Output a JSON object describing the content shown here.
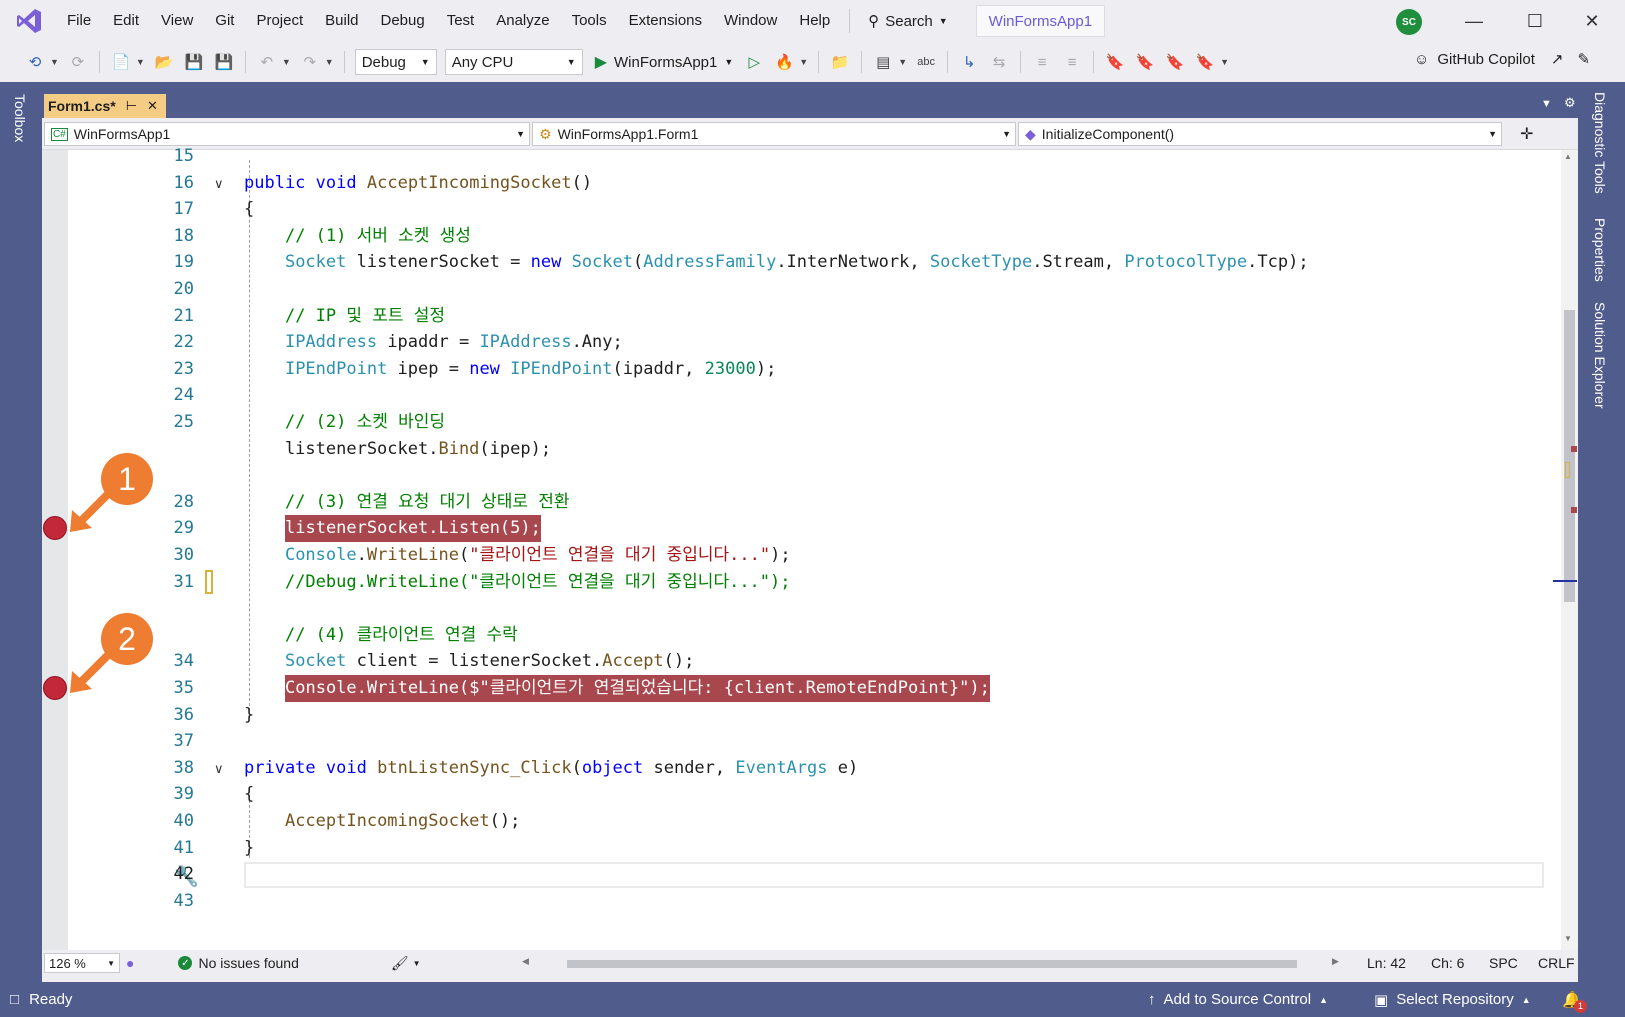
{
  "menu": {
    "items": [
      "File",
      "Edit",
      "View",
      "Git",
      "Project",
      "Build",
      "Debug",
      "Test",
      "Analyze",
      "Tools",
      "Extensions",
      "Window",
      "Help"
    ],
    "search_label": "Search",
    "solution_name": "WinFormsApp1",
    "avatar_initials": "SC"
  },
  "toolbar": {
    "configuration": "Debug",
    "platform": "Any CPU",
    "run_target": "WinFormsApp1",
    "copilot_label": "GitHub Copilot"
  },
  "side_tabs": {
    "left": "Toolbox",
    "right": [
      "Diagnostic Tools",
      "Properties",
      "Solution Explorer"
    ]
  },
  "document_tab": {
    "title": "Form1.cs*"
  },
  "navbar": {
    "project": "WinFormsApp1",
    "class": "WinFormsApp1.Form1",
    "member": "InitializeComponent()"
  },
  "editor": {
    "current_line": "42",
    "lines": [
      {
        "n": "15",
        "html": ""
      },
      {
        "n": "16",
        "html": "<span class='kw'>public</span> <span class='kw'>void</span> <span class='mt'>AcceptIncomingSocket</span>()"
      },
      {
        "n": "17",
        "html": "{"
      },
      {
        "n": "18",
        "html": "    <span class='cm'>// (1) 서버 소켓 생성</span>"
      },
      {
        "n": "19",
        "html": "    <span class='ty'>Socket</span> listenerSocket = <span class='kw'>new</span> <span class='ty'>Socket</span>(<span class='ty'>AddressFamily</span>.InterNetwork, <span class='ty'>SocketType</span>.Stream, <span class='ty'>ProtocolType</span>.Tcp);"
      },
      {
        "n": "20",
        "html": ""
      },
      {
        "n": "21",
        "html": "    <span class='cm'>// IP 및 포트 설정</span>"
      },
      {
        "n": "22",
        "html": "    <span class='ty'>IPAddress</span> ipaddr = <span class='ty'>IPAddress</span>.Any;"
      },
      {
        "n": "23",
        "html": "    <span class='ty'>IPEndPoint</span> ipep = <span class='kw'>new</span> <span class='ty'>IPEndPoint</span>(ipaddr, <span class='num'>23000</span>);"
      },
      {
        "n": "24",
        "html": ""
      },
      {
        "n": "25",
        "html": "    <span class='cm'>// (2) 소켓 바인딩</span>"
      },
      {
        "n": "",
        "html": "    listenerSocket.<span class='mt'>Bind</span>(ipep);"
      },
      {
        "n": "",
        "html": ""
      },
      {
        "n": "28",
        "html": "    <span class='cm'>// (3) 연결 요청 대기 상태로 전환</span>"
      },
      {
        "n": "29",
        "html": "listenerSocket.Listen(5);",
        "bp": true
      },
      {
        "n": "30",
        "html": "    <span class='ty'>Console</span>.<span class='mt'>WriteLine</span>(<span class='st'>\"클라이언트 연결을 대기 중입니다...\"</span>);"
      },
      {
        "n": "31",
        "html": "    <span class='cm'>//Debug.WriteLine(\"클라이언트 연결을 대기 중입니다...\");</span>",
        "changed": true
      },
      {
        "n": "",
        "html": ""
      },
      {
        "n": "",
        "html": "    <span class='cm'>// (4) 클라이언트 연결 수락</span>"
      },
      {
        "n": "34",
        "html": "    <span class='ty'>Socket</span> client = listenerSocket.<span class='mt'>Accept</span>();"
      },
      {
        "n": "35",
        "html": "Console.WriteLine($\"클라이언트가 연결되었습니다: {client.RemoteEndPoint}\");",
        "bp": true
      },
      {
        "n": "36",
        "html": "}"
      },
      {
        "n": "37",
        "html": ""
      },
      {
        "n": "38",
        "html": "<span class='kw'>private</span> <span class='kw'>void</span> <span class='mt'>btnListenSync_Click</span>(<span class='kw'>object</span> sender, <span class='ty'>EventArgs</span> e)"
      },
      {
        "n": "39",
        "html": "{"
      },
      {
        "n": "40",
        "html": "    <span class='mt'>AcceptIncomingSocket</span>();"
      },
      {
        "n": "41",
        "html": "}"
      },
      {
        "n": "42",
        "html": ""
      },
      {
        "n": "43",
        "html": ""
      }
    ]
  },
  "editor_status": {
    "zoom": "126 %",
    "issues": "No issues found",
    "line": "Ln: 42",
    "char": "Ch: 6",
    "spacing": "SPC",
    "line_ending": "CRLF"
  },
  "statusbar": {
    "ready": "Ready",
    "source_control": "Add to Source Control",
    "repository": "Select Repository",
    "notifications": "1"
  },
  "annotations": [
    {
      "label": "1"
    },
    {
      "label": "2"
    }
  ],
  "colors": {
    "frame": "#505d8c",
    "breakpoint_line": "#a8474e",
    "breakpoint_dot": "#c3273a",
    "badge": "#ee7c31",
    "tab_active": "#f5cc84"
  }
}
